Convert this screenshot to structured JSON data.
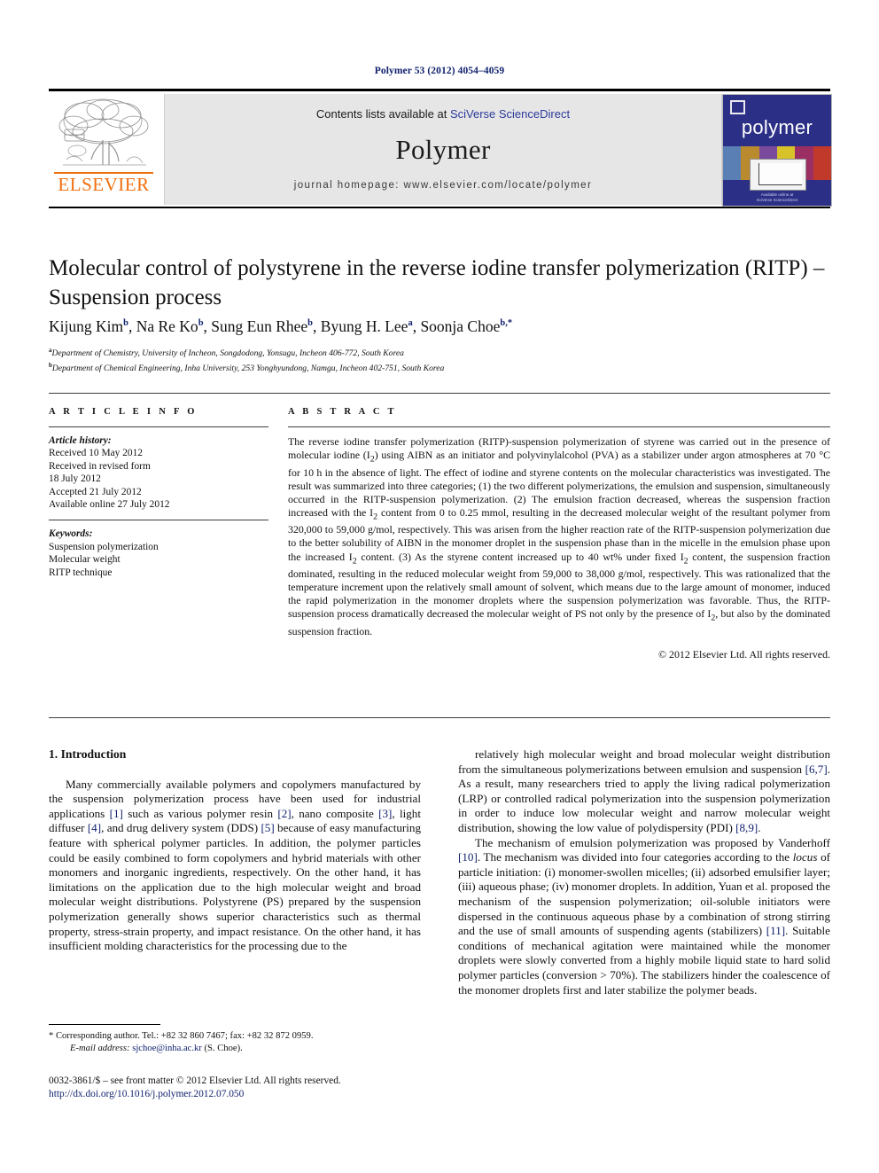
{
  "running_head": "Polymer 53 (2012) 4054–4059",
  "banner": {
    "publisher_name": "ELSEVIER",
    "publisher_logo_icon": "elsevier-tree-icon",
    "contents_prefix": "Contents lists available at ",
    "contents_link": "SciVerse ScienceDirect",
    "journal_name": "Polymer",
    "homepage": "journal homepage: www.elsevier.com/locate/polymer",
    "cover": {
      "title": "polymer",
      "logo_icon": "elsevier-shield-icon",
      "footer_line1": "Available online at",
      "footer_line2": "SciVerse ScienceDirect"
    }
  },
  "article": {
    "title": "Molecular control of polystyrene in the reverse iodine transfer polymerization (RITP) – Suspension process",
    "authors": [
      {
        "name": "Kijung Kim",
        "marks": "b"
      },
      {
        "name": "Na Re Ko",
        "marks": "b"
      },
      {
        "name": "Sung Eun Rhee",
        "marks": "b"
      },
      {
        "name": "Byung H. Lee",
        "marks": "a"
      },
      {
        "name": "Soonja Choe",
        "marks": "b,*"
      }
    ],
    "affiliations": [
      {
        "mark": "a",
        "text": "Department of Chemistry, University of Incheon, Songdodong, Yonsugu, Incheon 406-772, South Korea"
      },
      {
        "mark": "b",
        "text": "Department of Chemical Engineering, Inha University, 253 Yonghyundong, Namgu, Incheon 402-751, South Korea"
      }
    ]
  },
  "info": {
    "heading": "A R T I C L E   I N F O",
    "history_label": "Article history:",
    "history": [
      "Received 10 May 2012",
      "Received in revised form",
      "18 July 2012",
      "Accepted 21 July 2012",
      "Available online 27 July 2012"
    ],
    "keywords_label": "Keywords:",
    "keywords": [
      "Suspension polymerization",
      "Molecular weight",
      "RITP technique"
    ]
  },
  "abstract": {
    "heading": "A B S T R A C T",
    "paragraph_html": "The reverse iodine transfer polymerization (RITP)-suspension polymerization of styrene was carried out in the presence of molecular iodine (I<sub>2</sub>) using AIBN as an initiator and polyvinylalcohol (PVA) as a stabilizer under argon atmospheres at 70 &deg;C for 10 h in the absence of light. The effect of iodine and styrene contents on the molecular characteristics was investigated. The result was summarized into three categories; (1) the two different polymerizations, the emulsion and suspension, simultaneously occurred in the RITP-suspension polymerization. (2) The emulsion fraction decreased, whereas the suspension fraction increased with the I<sub>2</sub> content from 0 to 0.25 mmol, resulting in the decreased molecular weight of the resultant polymer from 320,000 to 59,000 g/mol, respectively. This was arisen from the higher reaction rate of the RITP-suspension polymerization due to the better solubility of AIBN in the monomer droplet in the suspension phase than in the micelle in the emulsion phase upon the increased I<sub>2</sub> content. (3) As the styrene content increased up to 40 wt% under fixed I<sub>2</sub> content, the suspension fraction dominated, resulting in the reduced molecular weight from 59,000 to 38,000 g/mol, respectively. This was rationalized that the temperature increment upon the relatively small amount of solvent, which means due to the large amount of monomer, induced the rapid polymerization in the monomer droplets where the suspension polymerization was favorable. Thus, the RITP-suspension process dramatically decreased the molecular weight of PS not only by the presence of I<sub>2</sub>, but also by the dominated suspension fraction.",
    "copyright": "© 2012 Elsevier Ltd. All rights reserved."
  },
  "introduction": {
    "section_number_title": "1. Introduction",
    "left_paragraph_html": "Many commercially available polymers and copolymers manufactured by the suspension polymerization process have been used for industrial applications <span class=\"ref\">[1]</span> such as various polymer resin <span class=\"ref\">[2]</span>, nano composite <span class=\"ref\">[3]</span>, light diffuser <span class=\"ref\">[4]</span>, and drug delivery system (DDS) <span class=\"ref\">[5]</span> because of easy manufacturing feature with spherical polymer particles. In addition, the polymer particles could be easily combined to form copolymers and hybrid materials with other monomers and inorganic ingredients, respectively. On the other hand, it has limitations on the application due to the high molecular weight and broad molecular weight distributions. Polystyrene (PS) prepared by the suspension polymerization generally shows superior characteristics such as thermal property, stress-strain property, and impact resistance. On the other hand, it has insufficient molding characteristics for the processing due to the",
    "right_paragraph1_html": "relatively high molecular weight and broad molecular weight distribution from the simultaneous polymerizations between emulsion and suspension <span class=\"ref\">[6,7]</span>. As a result, many researchers tried to apply the living radical polymerization (LRP) or controlled radical polymerization into the suspension polymerization in order to induce low molecular weight and narrow molecular weight distribution, showing the low value of polydispersity (PDI) <span class=\"ref\">[8,9]</span>.",
    "right_paragraph2_html": "The mechanism of emulsion polymerization was proposed by Vanderhoff <span class=\"ref\">[10]</span>. The mechanism was divided into four categories according to the <span class=\"it\">locus</span> of particle initiation: (i) monomer-swollen micelles; (ii) adsorbed emulsifier layer; (iii) aqueous phase; (iv) monomer droplets. In addition, Yuan et al. proposed the mechanism of the suspension polymerization; oil-soluble initiators were dispersed in the continuous aqueous phase by a combination of strong stirring and the use of small amounts of suspending agents (stabilizers) <span class=\"ref\">[11]</span>. Suitable conditions of mechanical agitation were maintained while the monomer droplets were slowly converted from a highly mobile liquid state to hard solid polymer particles (conversion &gt; 70%). The stabilizers hinder the coalescence of the monomer droplets first and later stabilize the polymer beads."
  },
  "footnote": {
    "line1": "* Corresponding author. Tel.: +82 32 860 7467; fax: +82 32 872 0959.",
    "email_label": "E-mail address:",
    "email": "sjchoe@inha.ac.kr",
    "email_suffix": "(S. Choe)."
  },
  "footer": {
    "line1": "0032-3861/$ – see front matter © 2012 Elsevier Ltd. All rights reserved.",
    "doi": "http://dx.doi.org/10.1016/j.polymer.2012.07.050"
  },
  "colors": {
    "link_blue": "#11216e",
    "sciencedirect_blue": "#2b3a9b",
    "elsevier_orange": "#f06f10",
    "cover_navy": "#2b2f86",
    "banner_grey": "#e6e6e6"
  }
}
